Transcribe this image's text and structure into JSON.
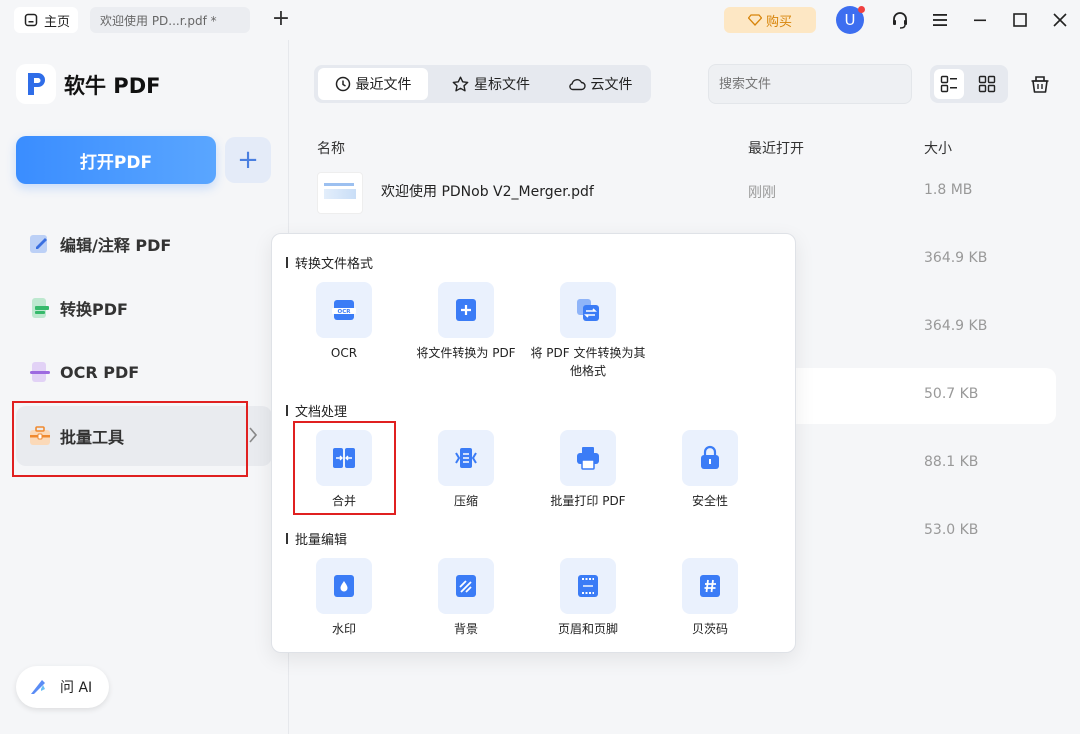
{
  "titlebar": {
    "home_tab": "主页",
    "doc_tab": "欢迎使用 PD...r.pdf *",
    "add_tab": "+",
    "buy_label": "购买",
    "avatar_letter": "U"
  },
  "sidebar": {
    "app_name": "软牛 PDF",
    "open_button": "打开PDF",
    "plus": "+",
    "items": [
      {
        "label": "编辑/注释 PDF",
        "icon": "edit-icon"
      },
      {
        "label": "转换PDF",
        "icon": "convert-icon"
      },
      {
        "label": "OCR PDF",
        "icon": "ocr-icon"
      },
      {
        "label": "批量工具",
        "icon": "batch-toolbox-icon"
      }
    ],
    "ai_button": "问 AI"
  },
  "main": {
    "tabs": [
      {
        "label": "最近文件",
        "icon": "clock-icon"
      },
      {
        "label": "星标文件",
        "icon": "star-icon"
      },
      {
        "label": "云文件",
        "icon": "cloud-icon"
      }
    ],
    "search_placeholder": "搜索文件",
    "columns": {
      "name": "名称",
      "recent": "最近打开",
      "size": "大小"
    },
    "files": [
      {
        "name": "欢迎使用 PDNob V2_Merger.pdf",
        "time": "刚刚",
        "size": "1.8 MB"
      },
      {
        "name": "",
        "time": "",
        "size": "364.9 KB"
      },
      {
        "name": "",
        "time": "",
        "size": "364.9 KB"
      },
      {
        "name": "",
        "time": "",
        "size": "50.7 KB"
      },
      {
        "name": "",
        "time": "",
        "size": "88.1 KB"
      },
      {
        "name": "",
        "time": "",
        "size": "53.0 KB"
      }
    ]
  },
  "popup": {
    "sections": [
      {
        "title": "转换文件格式",
        "tools": [
          {
            "label": "OCR",
            "icon": "ocr-icon"
          },
          {
            "label": "将文件转换为 PDF",
            "icon": "add-file-icon"
          },
          {
            "label": "将 PDF 文件转换为其他格式",
            "icon": "convert-format-icon"
          }
        ]
      },
      {
        "title": "文档处理",
        "tools": [
          {
            "label": "合并",
            "icon": "merge-icon"
          },
          {
            "label": "压缩",
            "icon": "compress-icon"
          },
          {
            "label": "批量打印 PDF",
            "icon": "printer-icon"
          },
          {
            "label": "安全性",
            "icon": "lock-icon"
          }
        ]
      },
      {
        "title": "批量编辑",
        "tools": [
          {
            "label": "水印",
            "icon": "watermark-icon"
          },
          {
            "label": "背景",
            "icon": "background-icon"
          },
          {
            "label": "页眉和页脚",
            "icon": "header-footer-icon"
          },
          {
            "label": "贝茨码",
            "icon": "bates-number-icon"
          }
        ]
      }
    ]
  },
  "colors": {
    "accent": "#3a8dff",
    "highlight": "#e02020",
    "tile_bg": "#eaf1fd"
  }
}
